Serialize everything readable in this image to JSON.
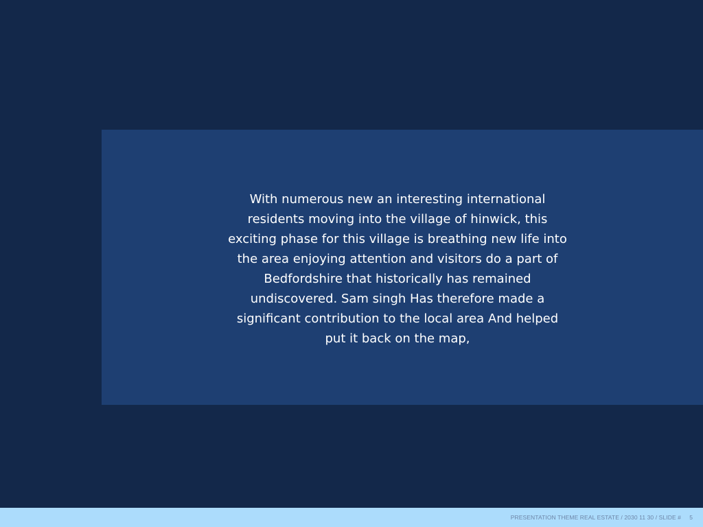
{
  "slide": {
    "body_text": "With numerous new an interesting international\nresidents moving into the village of hinwick, this\nexciting phase for this village is breathing new life into\nthe area enjoying attention and visitors do a part of\nBedfordshire that historically has remained\nundiscovered. Sam singh Has therefore made a\nsignificant contribution to the local area And helped\nput it back on the map,"
  },
  "footer": {
    "text": "PRESENTATION THEME REAL ESTATE / 2030 11 30 / SLIDE #",
    "slide_number": "5"
  },
  "colors": {
    "background": "#13284a",
    "panel": "#1e3f72",
    "footer_bar": "#acdcfc",
    "footer_text": "#6e86a8",
    "body_text": "#ffffff"
  }
}
